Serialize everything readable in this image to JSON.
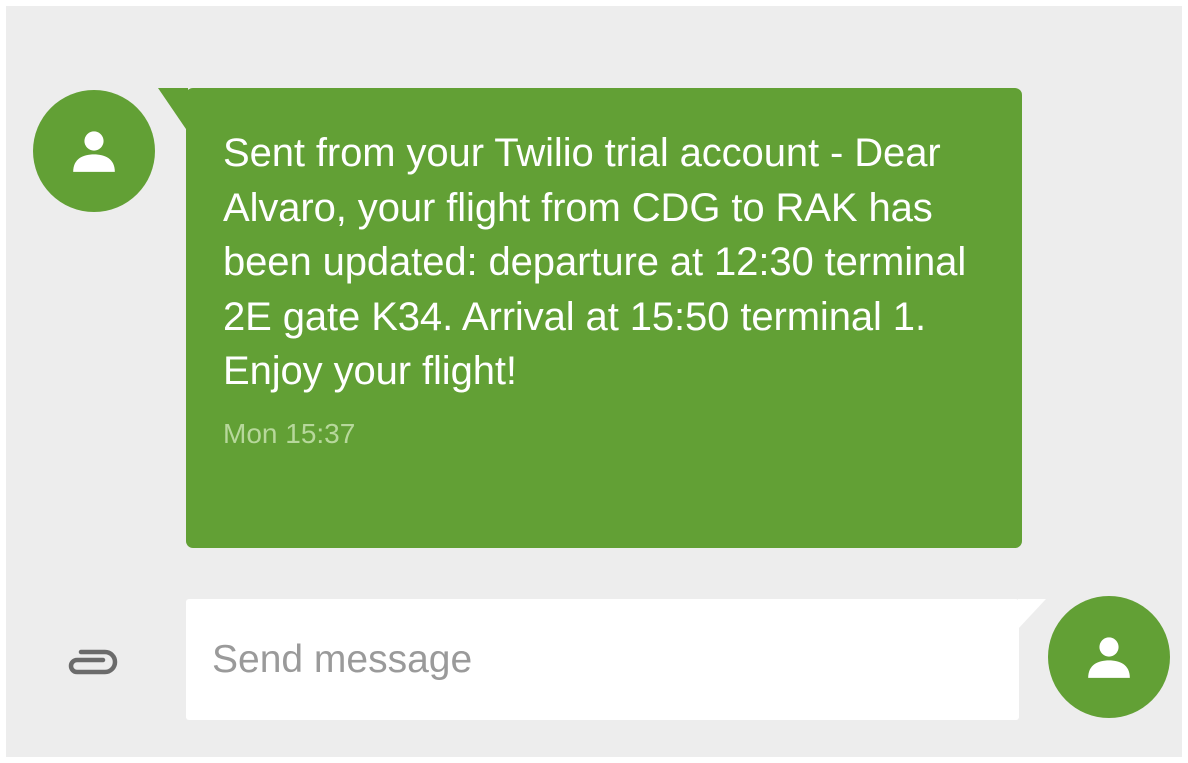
{
  "colors": {
    "accent": "#62a035",
    "background": "#ededed",
    "composer_background": "#ffffff",
    "icon_gray": "#6b6b6b"
  },
  "conversation": {
    "incoming_avatar_icon": "person-icon",
    "message": {
      "text": "Sent from your Twilio trial account - Dear Alvaro, your flight from CDG to RAK has been updated: departure at 12:30 terminal 2E gate K34. Arrival at 15:50 terminal 1. Enjoy your flight!",
      "timestamp": "Mon 15:37"
    }
  },
  "composer": {
    "attach_icon": "paperclip-icon",
    "placeholder": "Send message",
    "value": "",
    "send_avatar_icon": "person-icon"
  }
}
